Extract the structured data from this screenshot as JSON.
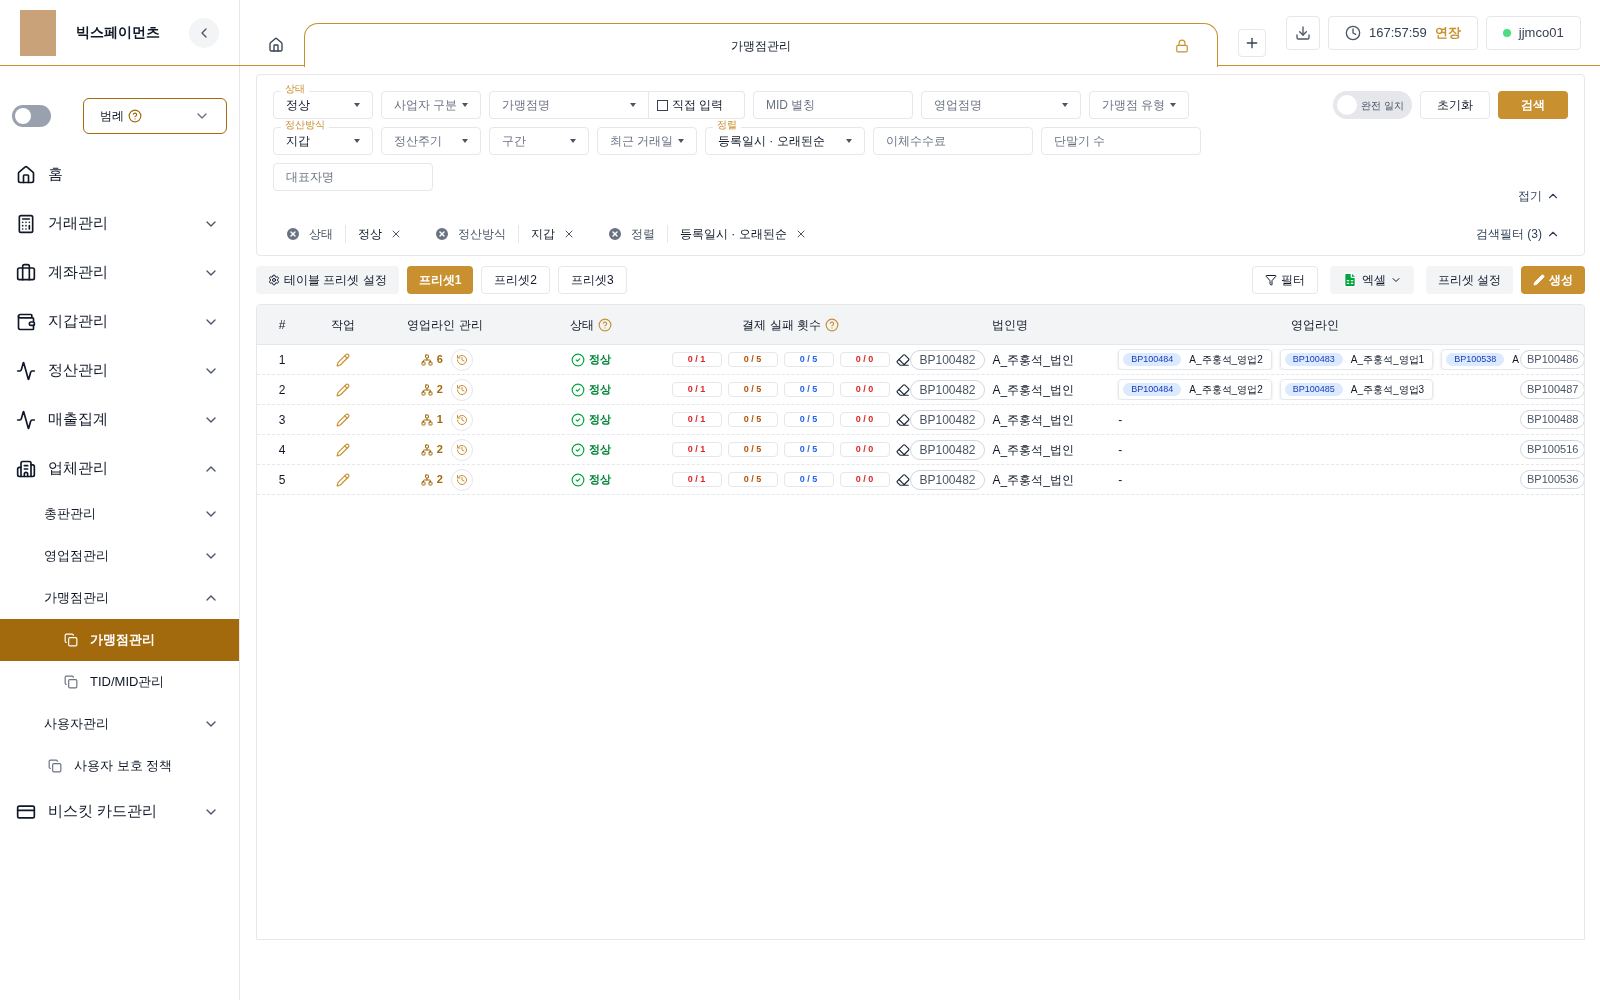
{
  "app": {
    "name": "빅스페이먼츠"
  },
  "sidebar": {
    "dark_mode": {
      "on": false
    },
    "legend": {
      "label": "범례"
    },
    "items": [
      {
        "kind": "page",
        "label": "홈",
        "selected": false
      },
      {
        "kind": "group",
        "label": "거래관리",
        "expanded": false
      },
      {
        "kind": "group",
        "label": "계좌관리",
        "expanded": false
      },
      {
        "kind": "group",
        "label": "지갑관리",
        "expanded": false
      },
      {
        "kind": "group",
        "label": "정산관리",
        "expanded": false
      },
      {
        "kind": "group",
        "label": "매출집계",
        "expanded": false
      },
      {
        "kind": "group",
        "label": "업체관리",
        "expanded": true,
        "children": [
          {
            "kind": "group",
            "label": "총판관리",
            "expanded": false
          },
          {
            "kind": "group",
            "label": "영업점관리",
            "expanded": false
          },
          {
            "kind": "group",
            "label": "가맹점관리",
            "expanded": true,
            "children": [
              {
                "kind": "page",
                "label": "가맹점관리",
                "selected": true
              },
              {
                "kind": "page",
                "label": "TID/MID관리",
                "selected": false
              }
            ]
          },
          {
            "kind": "group",
            "label": "사용자관리",
            "expanded": false
          },
          {
            "kind": "page",
            "label": "사용자 보호 정책",
            "selected": false
          }
        ]
      },
      {
        "kind": "group",
        "label": "비스킷 카드관리",
        "expanded": false
      }
    ]
  },
  "tabs": [
    {
      "label": "가맹점관리",
      "selected": true,
      "locked": true
    }
  ],
  "header": {
    "timer": "167:57:59",
    "extend": "연장",
    "user": "jjmco01",
    "online": true
  },
  "filters": {
    "lines": [
      {
        "fields": [
          {
            "kind": "select",
            "label": "상태",
            "value": "정상"
          },
          {
            "kind": "select",
            "placeholder": "사업자 구분"
          },
          {
            "kind": "select_checkbox",
            "placeholder": "가맹점명",
            "checkbox": {
              "label": "직접 입력",
              "checked": false
            }
          },
          {
            "kind": "input",
            "placeholder": "MID 별칭"
          },
          {
            "kind": "select",
            "placeholder": "영업점명"
          },
          {
            "kind": "select",
            "placeholder": "가맹점 유형"
          }
        ]
      },
      {
        "fields": [
          {
            "kind": "select",
            "label": "정산방식",
            "value": "지갑"
          },
          {
            "kind": "select",
            "placeholder": "정산주기"
          },
          {
            "kind": "select",
            "placeholder": "구간"
          },
          {
            "kind": "select",
            "placeholder": "최근 거래일"
          },
          {
            "kind": "select",
            "label": "정렬",
            "value": "등록일시 · 오래된순"
          },
          {
            "kind": "input",
            "placeholder": "이체수수료"
          },
          {
            "kind": "input",
            "placeholder": "단말기 수"
          }
        ]
      },
      {
        "fields": [
          {
            "kind": "input",
            "placeholder": "대표자명"
          }
        ]
      }
    ],
    "exact_match": {
      "label": "완전 일치",
      "on": false
    },
    "reset": "초기화",
    "search": "검색",
    "collapse": "접기",
    "chips": [
      {
        "name": "상태",
        "value": "정상"
      },
      {
        "name": "정산방식",
        "value": "지갑"
      },
      {
        "name": "정렬",
        "value": "등록일시 · 오래된순"
      }
    ],
    "filter_count": "검색필터 (3)"
  },
  "presets": {
    "settings": "테이블 프리셋 설정",
    "items": [
      {
        "label": "프리셋1",
        "selected": true
      },
      {
        "label": "프리셋2",
        "selected": false
      },
      {
        "label": "프리셋3",
        "selected": false
      }
    ]
  },
  "toolbar": {
    "filter": "필터",
    "excel": "엑셀",
    "preset_settings": "프리셋 설정",
    "create": "생성"
  },
  "table": {
    "columns": [
      {
        "label": "#"
      },
      {
        "label": "작업"
      },
      {
        "label": "영업라인 관리"
      },
      {
        "label": "상태",
        "help": true
      },
      {
        "label": "결제 실패 횟수",
        "help": true
      },
      {
        "label": "법인명"
      },
      {
        "label": "영업라인"
      }
    ],
    "rows": [
      {
        "index": "1",
        "line_count": "6",
        "status": "정상",
        "failures": [
          {
            "text": "0 / 1",
            "color": "#dc2626"
          },
          {
            "text": "0 / 5",
            "color": "#b45309"
          },
          {
            "text": "0 / 5",
            "color": "#2563eb"
          },
          {
            "text": "0 / 0",
            "color": "#dc2626"
          }
        ],
        "corp_id": "BP100482",
        "corp_name": "A_주홍석_법인",
        "sales_lines": [
          {
            "id": "BP100484",
            "name": "A_주홍석_영업2"
          },
          {
            "id": "BP100483",
            "name": "A_주홍석_영업1"
          },
          {
            "id": "BP100538",
            "name": "A"
          }
        ],
        "column_8": "BP100486"
      },
      {
        "index": "2",
        "line_count": "2",
        "status": "정상",
        "failures": [
          {
            "text": "0 / 1",
            "color": "#dc2626"
          },
          {
            "text": "0 / 5",
            "color": "#b45309"
          },
          {
            "text": "0 / 5",
            "color": "#2563eb"
          },
          {
            "text": "0 / 0",
            "color": "#dc2626"
          }
        ],
        "corp_id": "BP100482",
        "corp_name": "A_주홍석_법인",
        "sales_lines": [
          {
            "id": "BP100484",
            "name": "A_주홍석_영업2"
          },
          {
            "id": "BP100485",
            "name": "A_주홍석_영업3"
          }
        ],
        "column_8": "BP100487"
      },
      {
        "index": "3",
        "line_count": "1",
        "status": "정상",
        "failures": [
          {
            "text": "0 / 1",
            "color": "#dc2626"
          },
          {
            "text": "0 / 5",
            "color": "#b45309"
          },
          {
            "text": "0 / 5",
            "color": "#2563eb"
          },
          {
            "text": "0 / 0",
            "color": "#dc2626"
          }
        ],
        "corp_id": "BP100482",
        "corp_name": "A_주홍석_법인",
        "sales_lines_empty": "-",
        "column_8": "BP100488"
      },
      {
        "index": "4",
        "line_count": "2",
        "status": "정상",
        "failures": [
          {
            "text": "0 / 1",
            "color": "#dc2626"
          },
          {
            "text": "0 / 5",
            "color": "#b45309"
          },
          {
            "text": "0 / 5",
            "color": "#2563eb"
          },
          {
            "text": "0 / 0",
            "color": "#dc2626"
          }
        ],
        "corp_id": "BP100482",
        "corp_name": "A_주홍석_법인",
        "sales_lines_empty": "-",
        "column_8": "BP100516"
      },
      {
        "index": "5",
        "line_count": "2",
        "status": "정상",
        "failures": [
          {
            "text": "0 / 1",
            "color": "#dc2626"
          },
          {
            "text": "0 / 5",
            "color": "#b45309"
          },
          {
            "text": "0 / 5",
            "color": "#2563eb"
          },
          {
            "text": "0 / 0",
            "color": "#dc2626"
          }
        ],
        "corp_id": "BP100482",
        "corp_name": "A_주홍석_법인",
        "sales_lines_empty": "-",
        "column_8": "BP100536"
      }
    ]
  }
}
